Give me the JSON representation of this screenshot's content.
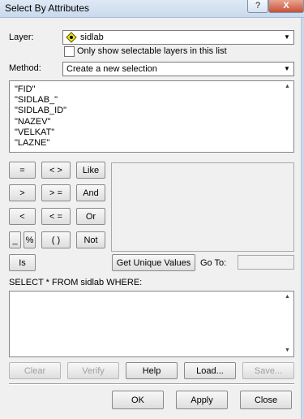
{
  "window": {
    "title": "Select By Attributes",
    "help_glyph": "?",
    "close_glyph": "X"
  },
  "layer": {
    "label": "Layer:",
    "value": "sidlab",
    "only_selectable_label": "Only show selectable layers in this list",
    "only_selectable_checked": false
  },
  "method": {
    "label": "Method:",
    "value": "Create a new selection"
  },
  "fields": [
    "\"FID\"",
    "\"SIDLAB_\"",
    "\"SIDLAB_ID\"",
    "\"NAZEV\"",
    "\"VELKAT\"",
    "\"LAZNE\""
  ],
  "operators": {
    "eq": "=",
    "ne": "< >",
    "like": "Like",
    "gt": ">",
    "ge": "> =",
    "and": "And",
    "lt": "<",
    "le": "< =",
    "or": "Or",
    "underscore": "_",
    "percent": "%",
    "parens": "( )",
    "not": "Not",
    "is": "Is"
  },
  "values": {
    "get_unique_label": "Get Unique Values",
    "goto_label": "Go To:",
    "goto_value": ""
  },
  "expression": {
    "prefix": "SELECT * FROM sidlab WHERE:",
    "text": ""
  },
  "actions": {
    "clear": "Clear",
    "verify": "Verify",
    "help": "Help",
    "load": "Load...",
    "save": "Save..."
  },
  "dialog": {
    "ok": "OK",
    "apply": "Apply",
    "close": "Close"
  },
  "icons": {
    "layer_icon": "feature-layer-icon",
    "combo_arrow": "chevron-down-icon"
  }
}
